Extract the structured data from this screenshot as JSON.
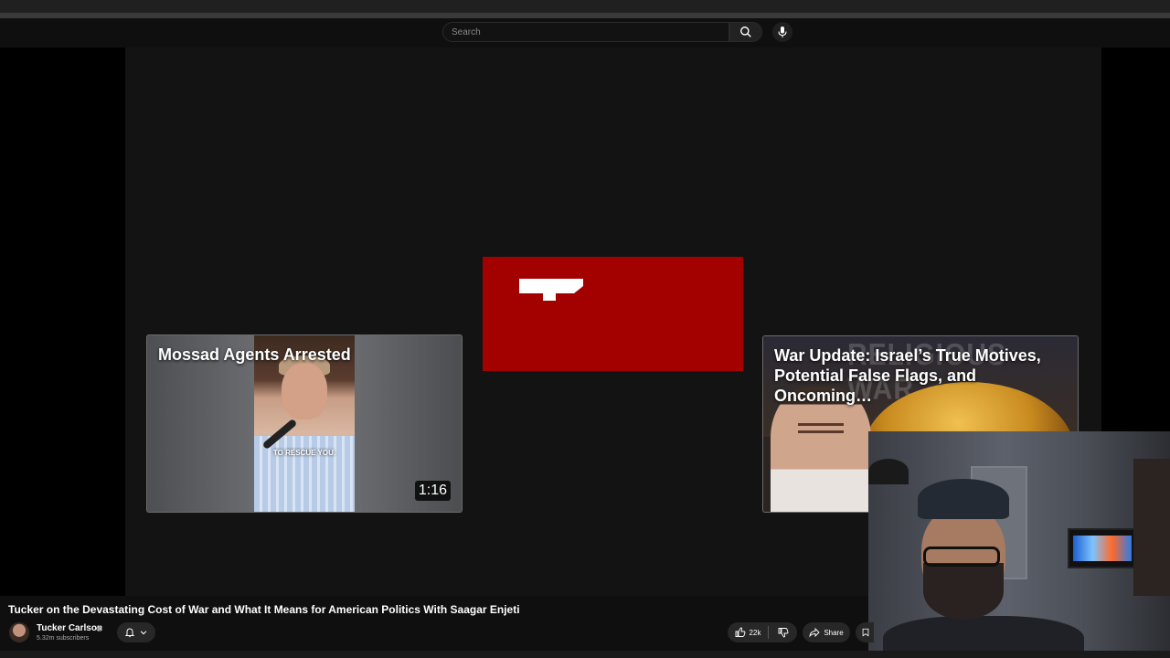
{
  "search": {
    "placeholder": "Search"
  },
  "end_cards": [
    {
      "title": "Mossad Agents Arrested",
      "caption": "TO RESCUE YOU.",
      "duration": "1:16"
    },
    {
      "title": "War Update: Israel’s True Motives, Potential False Flags, and Oncoming…",
      "overlay_text": "RELIGIOUS WAR"
    }
  ],
  "subscribe_card": {
    "color": "#a30000"
  },
  "video": {
    "title": "Tucker on the Devastating Cost of War and What It Means for American Politics With Saagar Enjeti",
    "channel": "Tucker Carlson",
    "verified": "◉",
    "subscribers": "5.32m subscribers",
    "likes": "22k",
    "share_label": "Share"
  },
  "icons": [
    "search-icon",
    "mic-icon",
    "bell-icon",
    "chevron-down-icon",
    "like-icon",
    "dislike-icon",
    "share-icon",
    "save-icon"
  ],
  "colors": {
    "background": "#0f0f0f",
    "player": "#131313",
    "accent_red": "#a30000",
    "pill": "#272727"
  }
}
